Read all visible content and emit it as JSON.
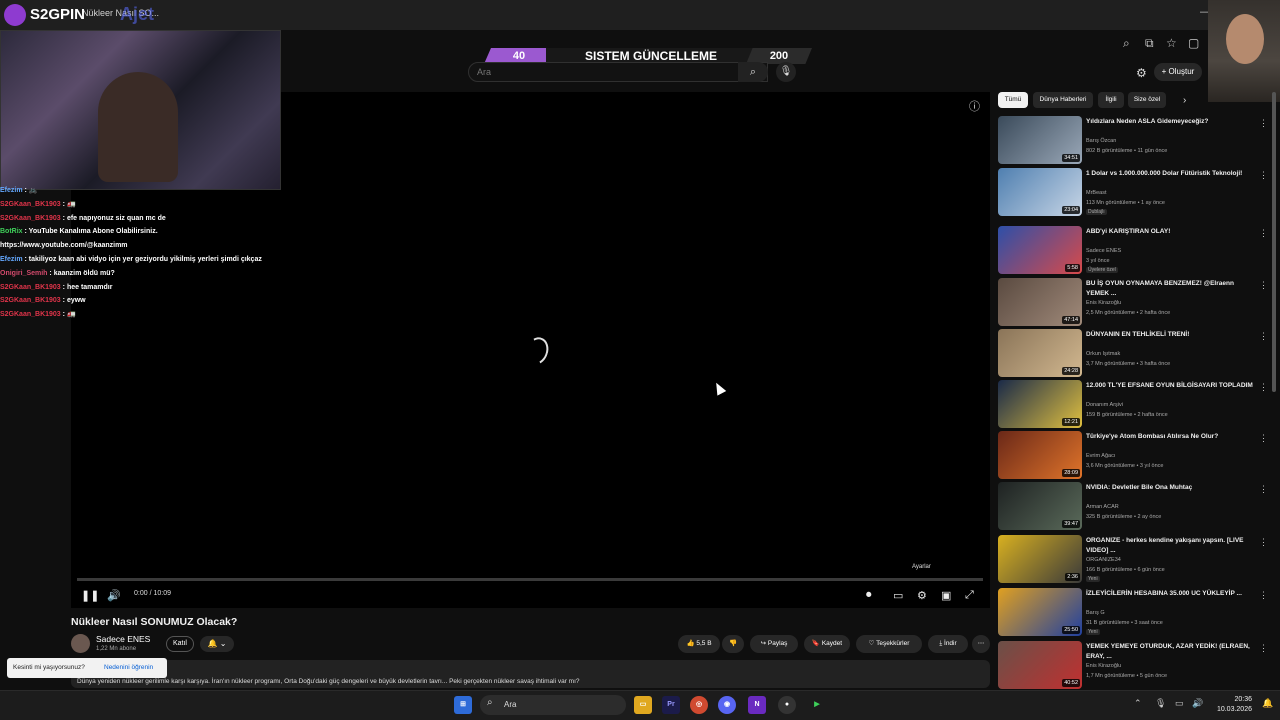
{
  "browser": {
    "tab_title": "Nükleer Nasıl SO... ",
    "overlay_logo": "S2GPIN",
    "overlay_text": "Ajet"
  },
  "banner": {
    "left_number": "40",
    "title": "SISTEM GÜNCELLEME",
    "right_number": "200"
  },
  "header": {
    "search_placeholder": "Ara",
    "create_label": "Oluştur"
  },
  "chat": [
    {
      "user": "Efezim",
      "sep": " : ",
      "msg": "🚲",
      "color": "b"
    },
    {
      "user": "S2GKaan_BK1903",
      "sep": " : ",
      "msg": "🚛",
      "color": "r"
    },
    {
      "user": "S2GKaan_BK1903",
      "sep": " : ",
      "msg": "efe napıyonuz siz quan mc de",
      "color": "r"
    },
    {
      "user": "BotRix",
      "sep": " : ",
      "msg": "YouTube Kanalıma Abone Olabilirsiniz.",
      "color": "g"
    },
    {
      "user": "",
      "sep": "",
      "msg": "https://www.youtube.com/@kaanzimm",
      "color": "w"
    },
    {
      "user": "Efezim",
      "sep": " : ",
      "msg": "takiliyoz kaan abi vidyo için yer geziyordu yikilmiş yerleri şimdi çıkçaz",
      "color": "b"
    },
    {
      "user": "Onigiri_Semih",
      "sep": " : ",
      "msg": "kaanzim öldü mü?",
      "color": "o"
    },
    {
      "user": "S2GKaan_BK1903",
      "sep": " : ",
      "msg": "hee tamamdır",
      "color": "r"
    },
    {
      "user": "S2GKaan_BK1903",
      "sep": " : ",
      "msg": "eyww",
      "color": "r"
    },
    {
      "user": "S2GKaan_BK1903",
      "sep": " : ",
      "msg": "🚛",
      "color": "r"
    }
  ],
  "player": {
    "time": "0:00 / 10:09",
    "settings_tooltip": "Ayarlar",
    "progress_fraction": 0
  },
  "video": {
    "title": "Nükleer Nasıl SONUMUZ Olacak?",
    "channel": "Sadece ENES",
    "subscribers": "1,22 Mn abone",
    "join_label": "Katıl",
    "likes": "5,5 B",
    "share_label": "Paylaş",
    "save_label": "Kaydet",
    "thanks_label": "Teşekkürler",
    "download_label": "İndir",
    "description": "Dünya yeniden nükleer gerilimle karşı karşıya. İran'ın nükleer programı, Orta Doğu'daki güç dengeleri ve büyük devletlerin tavrı... Peki gerçekten nükleer savaş ihtimali var mı?"
  },
  "toast": {
    "question": "Kesinti mi yaşıyorsunuz?",
    "link": "Nedenini öğrenin"
  },
  "chips": [
    "Tümü",
    "Dünya Haberleri",
    "İlgili",
    "Size özel"
  ],
  "recommendations": [
    {
      "title": "Yıldızlara Neden ASLA Gidemeyeceğiz?",
      "channel": "Barış Özcan",
      "meta": "802 B görüntüleme • 11 gün önce",
      "duration": "34:51",
      "badge": "",
      "color1": "#3a4a5a",
      "color2": "#9aa8b8"
    },
    {
      "title": "1 Dolar vs 1.000.000.000 Dolar Fütüristik Teknoloji!",
      "channel": "MrBeast",
      "meta": "113 Mn görüntüleme • 1 ay önce",
      "duration": "23:04",
      "badge": "Dublajlı",
      "color1": "#4f7fb0",
      "color2": "#c8d6e6"
    },
    {
      "title": "ABD'yi KARIŞTIRAN OLAY!",
      "channel": "Sadece ENES",
      "meta": "3 yıl önce",
      "duration": "5:58",
      "badge": "Üyelere özel",
      "color1": "#2d4fa8",
      "color2": "#d84a4a"
    },
    {
      "title": "BU İŞ OYUN OYNAMAYA BENZEMEZ! @Elraenn YEMEK ...",
      "channel": "Enis Kirazoğlu",
      "meta": "2,5 Mn görüntüleme • 2 hafta önce",
      "duration": "47:14",
      "badge": "",
      "color1": "#5a4a40",
      "color2": "#a08a7a"
    },
    {
      "title": "DÜNYANIN EN TEHLİKELİ TRENİ!",
      "channel": "Orkun Işıtmak",
      "meta": "3,7 Mn görüntüleme • 3 hafta önce",
      "duration": "24:28",
      "badge": "",
      "color1": "#8a7458",
      "color2": "#d2b890"
    },
    {
      "title": "12.000 TL'YE EFSANE OYUN BİLGİSAYARI TOPLADIM",
      "channel": "Donanım Arşivi",
      "meta": "159 B görüntüleme • 2 hafta önce",
      "duration": "12:21",
      "badge": "",
      "color1": "#1a2a48",
      "color2": "#e0c040"
    },
    {
      "title": "Türkiye'ye Atom Bombası Atılırsa Ne Olur?",
      "channel": "Evrim Ağacı",
      "meta": "3,6 Mn görüntüleme • 3 yıl önce",
      "duration": "28:09",
      "badge": "",
      "color1": "#6a2818",
      "color2": "#e0742a"
    },
    {
      "title": "NVIDIA: Devletler Bile Ona Muhtaç",
      "channel": "Arman ACAR",
      "meta": "325 B görüntüleme • 2 ay önce",
      "duration": "39:47",
      "badge": "",
      "color1": "#1e2222",
      "color2": "#5a6a5a"
    },
    {
      "title": "ORGANIZE - herkes kendine yakışanı yapsın. [LIVE VIDEO] ...",
      "channel": "ORGANIZE34",
      "meta": "166 B görüntüleme • 6 gün önce",
      "duration": "2:36",
      "badge": "Yeni",
      "color1": "#d8b020",
      "color2": "#3a3a3a"
    },
    {
      "title": "İZLEYİCİLERİN HESABINA 35.000 UC YÜKLEYİP ...",
      "channel": "Barış G",
      "meta": "31 B görüntüleme • 3 saat önce",
      "duration": "25:50",
      "badge": "Yeni",
      "color1": "#e0a020",
      "color2": "#2040a0"
    },
    {
      "title": "YEMEK YEMEYE OTURDUK, AZAR YEDİK! (ELRAEN, ERAY, ...",
      "channel": "Enis Kirazoğlu",
      "meta": "1,7 Mn görüntüleme • 5 gün önce",
      "duration": "40:52",
      "badge": "",
      "color1": "#6a5048",
      "color2": "#c03030"
    }
  ],
  "taskbar": {
    "search_label": "Ara",
    "time": "20:36",
    "date": "10.03.2026"
  }
}
